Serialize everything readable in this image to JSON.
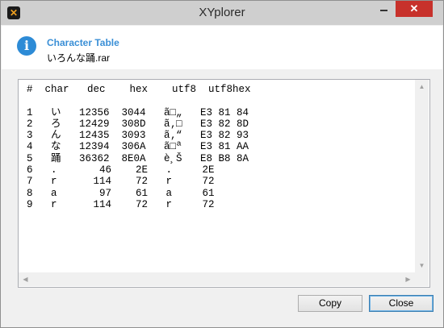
{
  "window": {
    "title": "XYplorer",
    "close_symbol": "✕"
  },
  "dialog": {
    "heading": "Character Table",
    "filename": "いろんな踊.rar"
  },
  "table": {
    "header": "#  char   dec    hex    utf8  utf8hex",
    "rows": [
      "1   い   12356  3044   ã□„   E3 81 84",
      "2   ろ   12429  308D   ã‚□   E3 82 8D",
      "3   ん   12435  3093   ã‚“   E3 82 93",
      "4   な   12394  306A   ã□ª   E3 81 AA",
      "5   踊   36362  8E0A   è¸Š   E8 B8 8A",
      "6   .       46    2E   .     2E",
      "7   r      114    72   r     72",
      "8   a       97    61   a     61",
      "9   r      114    72   r     72"
    ]
  },
  "buttons": {
    "copy": "Copy",
    "close": "Close"
  }
}
